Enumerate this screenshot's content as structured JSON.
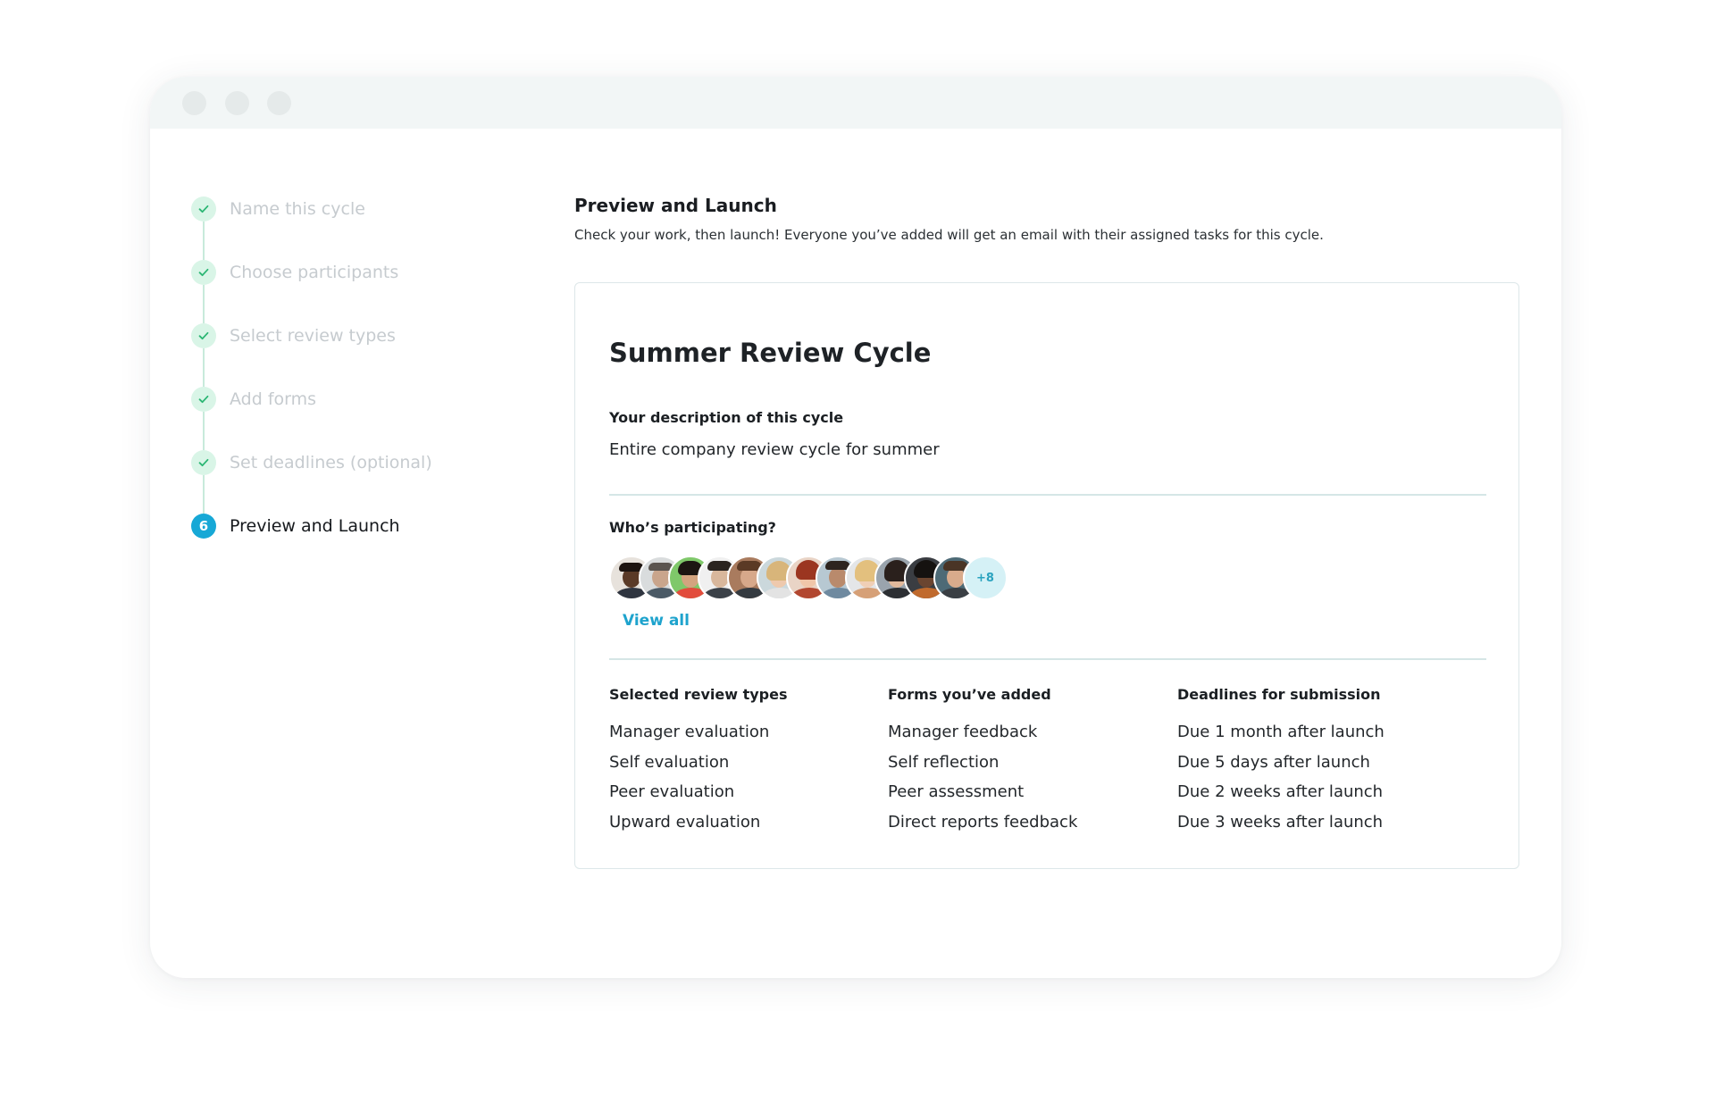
{
  "window": {
    "controls": [
      "close",
      "minimize",
      "maximize"
    ]
  },
  "stepper": {
    "steps": [
      {
        "label": "Name this cycle",
        "status": "complete",
        "icon": "check-icon"
      },
      {
        "label": "Choose participants",
        "status": "complete",
        "icon": "check-icon"
      },
      {
        "label": "Select review types",
        "status": "complete",
        "icon": "check-icon"
      },
      {
        "label": "Add forms",
        "status": "complete",
        "icon": "check-icon"
      },
      {
        "label": "Set deadlines (optional)",
        "status": "complete",
        "icon": "check-icon"
      },
      {
        "label": "Preview and Launch",
        "status": "active",
        "number": "6"
      }
    ]
  },
  "main": {
    "title": "Preview and Launch",
    "subtitle": "Check your work, then launch! Everyone you’ve added will get an email with their assigned tasks for this cycle."
  },
  "card": {
    "title": "Summer Review Cycle",
    "description_label": "Your description of this cycle",
    "description_value": "Entire company review cycle for summer",
    "participants_label": "Who’s participating?",
    "participants_more": "+8",
    "view_all": "View all",
    "columns": [
      {
        "header": "Selected review types",
        "items": [
          "Manager evaluation",
          "Self evaluation",
          "Peer evaluation",
          "Upward evaluation"
        ]
      },
      {
        "header": "Forms you’ve added",
        "items": [
          "Manager feedback",
          "Self reflection",
          "Peer assessment",
          "Direct reports feedback"
        ]
      },
      {
        "header": "Deadlines for submission",
        "items": [
          "Due 1 month after launch",
          "Due 5 days after launch",
          "Due 2 weeks after launch",
          "Due 3 weeks after launch"
        ]
      }
    ]
  },
  "colors": {
    "accent": "#17a8d6",
    "complete_bg": "#d9f5e7",
    "complete_check": "#2bb673",
    "muted_text": "#c6cbcf"
  }
}
